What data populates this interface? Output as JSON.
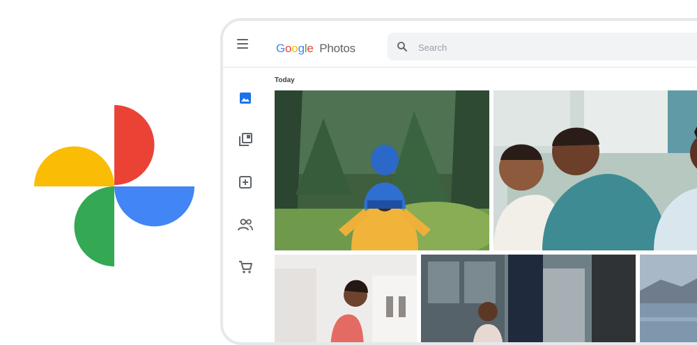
{
  "app": {
    "brand_letters": [
      "G",
      "o",
      "o",
      "g",
      "l",
      "e"
    ],
    "brand_colors": [
      "#4285F4",
      "#EA4335",
      "#FBBC05",
      "#4285F4",
      "#34A853",
      "#EA4335"
    ],
    "product_name": "Photos"
  },
  "search": {
    "placeholder": "Search"
  },
  "sidebar": {
    "items": [
      {
        "icon": "photos-icon",
        "active": true
      },
      {
        "icon": "albums-icon",
        "active": false
      },
      {
        "icon": "add-to-library-icon",
        "active": false
      },
      {
        "icon": "sharing-icon",
        "active": false
      },
      {
        "icon": "shopping-cart-icon",
        "active": false
      }
    ]
  },
  "main": {
    "section_title": "Today",
    "photos": [
      {
        "name": "photo-hiker-child-forest"
      },
      {
        "name": "photo-family-laughing-couch"
      },
      {
        "name": "photo-woman-at-counter"
      },
      {
        "name": "photo-child-in-kitchen"
      },
      {
        "name": "photo-lake-mountains"
      }
    ]
  },
  "colors": {
    "logo_red": "#EA4335",
    "logo_yellow": "#FBBC05",
    "logo_green": "#34A853",
    "logo_blue": "#4285F4",
    "accent_blue": "#1a73e8"
  }
}
